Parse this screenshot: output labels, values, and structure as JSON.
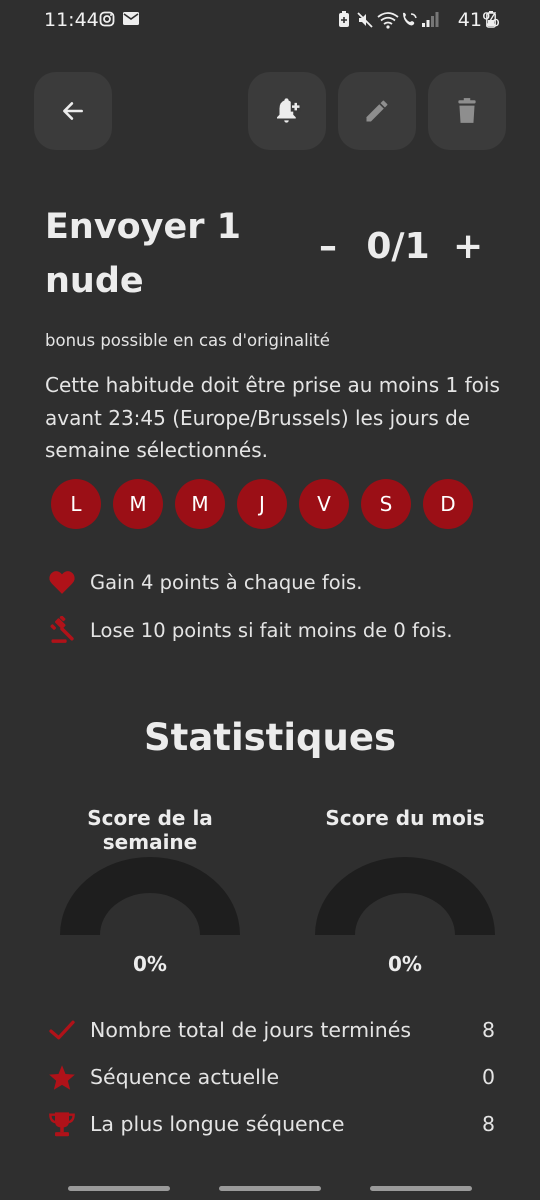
{
  "status_bar": {
    "time": "11:44",
    "battery": "41%"
  },
  "habit": {
    "title": "Envoyer 1 nude",
    "count": "0/1",
    "minus": "–",
    "plus": "+",
    "subtitle": "bonus possible en cas d'originalité",
    "description": "Cette habitude doit être prise au moins 1 fois avant 23:45 (Europe/Brussels) les jours de semaine sélectionnés.",
    "days": [
      "L",
      "M",
      "M",
      "J",
      "V",
      "S",
      "D"
    ],
    "rules": [
      {
        "icon": "heart-icon",
        "text": "Gain 4 points à chaque fois."
      },
      {
        "icon": "gavel-icon",
        "text": "Lose 10 points si fait moins de 0 fois."
      }
    ]
  },
  "stats": {
    "title": "Statistiques",
    "week": {
      "label": "Score de la semaine",
      "value": "0%"
    },
    "month": {
      "label": "Score du mois",
      "value": "0%"
    },
    "rows": [
      {
        "icon": "check-icon",
        "label": "Nombre total de jours terminés",
        "value": "8"
      },
      {
        "icon": "star-icon",
        "label": "Séquence actuelle",
        "value": "0"
      },
      {
        "icon": "trophy-icon",
        "label": "La plus longue séquence",
        "value": "8"
      }
    ]
  },
  "colors": {
    "accent": "#9b0f16",
    "background": "#2f2f2f",
    "button": "#3b3b3b",
    "gauge": "#1e1e1e"
  }
}
